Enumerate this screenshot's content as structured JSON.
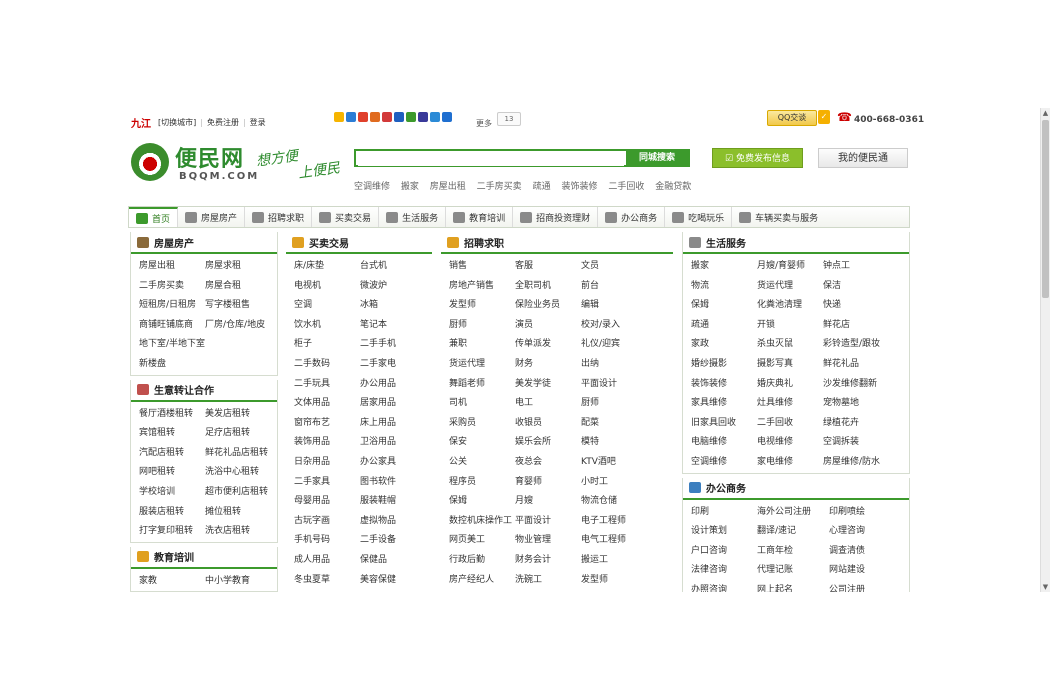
{
  "topbar": {
    "city": "九江",
    "switch_city": "[切换城市]",
    "register": "免费注册",
    "login": "登录",
    "more": "更多",
    "share_count": "13",
    "qq_service": "QQ交谈",
    "phone": "400-668-0361"
  },
  "header": {
    "logo_cn": "便民网",
    "logo_en": "BQQM.COM",
    "slogan_line1": "想方便",
    "slogan_line2": "上便民",
    "search_placeholder": "",
    "search_button": "同城搜索",
    "hot_searches": [
      "空调维修",
      "搬家",
      "房屋出租",
      "二手房买卖",
      "疏通",
      "装饰装修",
      "二手回收",
      "金融贷款"
    ],
    "publish_button": "免费发布信息",
    "my_button": "我的便民通"
  },
  "nav": [
    {
      "label": "首页",
      "icon": "home-icon"
    },
    {
      "label": "房屋房产",
      "icon": "house-icon"
    },
    {
      "label": "招聘求职",
      "icon": "people-icon"
    },
    {
      "label": "买卖交易",
      "icon": "cart-icon"
    },
    {
      "label": "生活服务",
      "icon": "cup-icon"
    },
    {
      "label": "教育培训",
      "icon": "education-icon"
    },
    {
      "label": "招商投资理财",
      "icon": "money-icon"
    },
    {
      "label": "办公商务",
      "icon": "office-icon"
    },
    {
      "label": "吃喝玩乐",
      "icon": "food-icon"
    },
    {
      "label": "车辆买卖与服务",
      "icon": "car-icon"
    }
  ],
  "sections": {
    "house": {
      "title": "房屋房产",
      "items": [
        "房屋出租",
        "房屋求租",
        "二手房买卖",
        "房屋合租",
        "短租房/日租房",
        "写字楼租售",
        "商铺旺铺底商",
        "厂房/仓库/地皮",
        "地下室/半地下室",
        "",
        "新楼盘",
        ""
      ]
    },
    "transfer": {
      "title": "生意转让合作",
      "items": [
        "餐厅酒楼租转",
        "美发店租转",
        "宾馆租转",
        "足疗店租转",
        "汽配店租转",
        "鲜花礼品店租转",
        "网吧租转",
        "洗浴中心租转",
        "学校培训",
        "超市便利店租转",
        "服装店租转",
        "摊位租转",
        "打字复印租转",
        "洗衣店租转"
      ]
    },
    "edu": {
      "title": "教育培训",
      "items": [
        "家教",
        "中小学教育"
      ]
    },
    "trade": {
      "title": "买卖交易",
      "items": [
        "床/床垫",
        "台式机",
        "电视机",
        "微波炉",
        "空调",
        "冰箱",
        "饮水机",
        "笔记本",
        "柜子",
        "二手手机",
        "二手数码",
        "二手家电",
        "二手玩具",
        "办公用品",
        "文体用品",
        "居家用品",
        "窗帘布艺",
        "床上用品",
        "装饰用品",
        "卫浴用品",
        "日杂用品",
        "办公家具",
        "二手家具",
        "图书软件",
        "母婴用品",
        "服装鞋帽",
        "古玩字画",
        "虚拟物品",
        "手机号码",
        "二手设备",
        "成人用品",
        "保健品",
        "冬虫夏草",
        "美容保健"
      ]
    },
    "jobs": {
      "title": "招聘求职",
      "items": [
        "销售",
        "客服",
        "文员",
        "房地产销售",
        "全职司机",
        "前台",
        "发型师",
        "保险业务员",
        "编辑",
        "厨师",
        "演员",
        "校对/录入",
        "兼职",
        "传单派发",
        "礼仪/迎宾",
        "货运代理",
        "财务",
        "出纳",
        "舞蹈老师",
        "美发学徒",
        "平面设计",
        "司机",
        "电工",
        "厨师",
        "采购员",
        "收银员",
        "配菜",
        "保安",
        "娱乐会所",
        "模特",
        "公关",
        "夜总会",
        "KTV酒吧",
        "程序员",
        "育婴师",
        "小时工",
        "保姆",
        "月嫂",
        "物流仓储",
        "数控机床操作工",
        "平面设计",
        "电子工程师",
        "网页美工",
        "物业管理",
        "电气工程师",
        "行政后勤",
        "财务会计",
        "搬运工",
        "房产经纪人",
        "洗碗工",
        "发型师"
      ]
    },
    "life": {
      "title": "生活服务",
      "items": [
        "搬家",
        "月嫂/育婴师",
        "钟点工",
        "物流",
        "货运代理",
        "保洁",
        "保姆",
        "化粪池清理",
        "快递",
        "疏通",
        "开锁",
        "鲜花店",
        "家政",
        "杀虫灭鼠",
        "彩铃造型/跟妆",
        "婚纱摄影",
        "摄影写真",
        "鲜花礼品",
        "装饰装修",
        "婚庆典礼",
        "沙发维修翻新",
        "家具维修",
        "灶具维修",
        "宠物墓地",
        "旧家具回收",
        "二手回收",
        "绿植花卉",
        "电脑维修",
        "电视维修",
        "空调拆装",
        "空调维修",
        "家电维修",
        "房屋维修/防水"
      ]
    },
    "office": {
      "title": "办公商务",
      "items": [
        "印刷",
        "海外公司注册",
        "印刷喷绘",
        "设计策划",
        "翻译/速记",
        "心理咨询",
        "户口咨询",
        "工商年检",
        "调查清债",
        "法律咨询",
        "代理记账",
        "网站建设",
        "办照咨询",
        "网上起名",
        "公司注册"
      ]
    }
  }
}
